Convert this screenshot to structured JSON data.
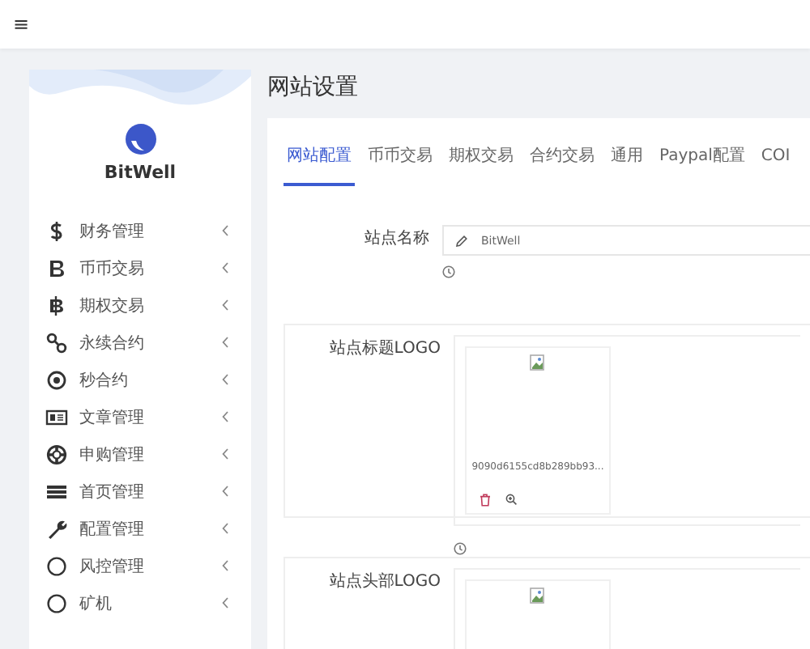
{
  "top_bar": {
    "menu_icon": "≡"
  },
  "sidebar": {
    "brand": "BitWell",
    "items": [
      {
        "label": "财务管理"
      },
      {
        "label": "币币交易"
      },
      {
        "label": "期权交易"
      },
      {
        "label": "永续合约"
      },
      {
        "label": "秒合约"
      },
      {
        "label": "文章管理"
      },
      {
        "label": "申购管理"
      },
      {
        "label": "首页管理"
      },
      {
        "label": "配置管理"
      },
      {
        "label": "风控管理"
      },
      {
        "label": "矿机"
      }
    ]
  },
  "page_title": "网站设置",
  "tabs": [
    {
      "label": "网站配置",
      "selected": true
    },
    {
      "label": "币币交易",
      "selected": false
    },
    {
      "label": "期权交易",
      "selected": false
    },
    {
      "label": "合约交易",
      "selected": false
    },
    {
      "label": "通用",
      "selected": false
    },
    {
      "label": "Paypal配置",
      "selected": false
    },
    {
      "label": "COI",
      "selected": false
    }
  ],
  "fields": [
    {
      "kind": "text",
      "label": "站点名称",
      "value": "BitWell",
      "help_icon": true
    },
    {
      "kind": "upload",
      "label": "站点标题LOGO",
      "file_name": "9090d6155cd8b289bb93...",
      "help_icon": true
    },
    {
      "kind": "upload",
      "label": "站点头部LOGO",
      "help_icon": false
    }
  ]
}
